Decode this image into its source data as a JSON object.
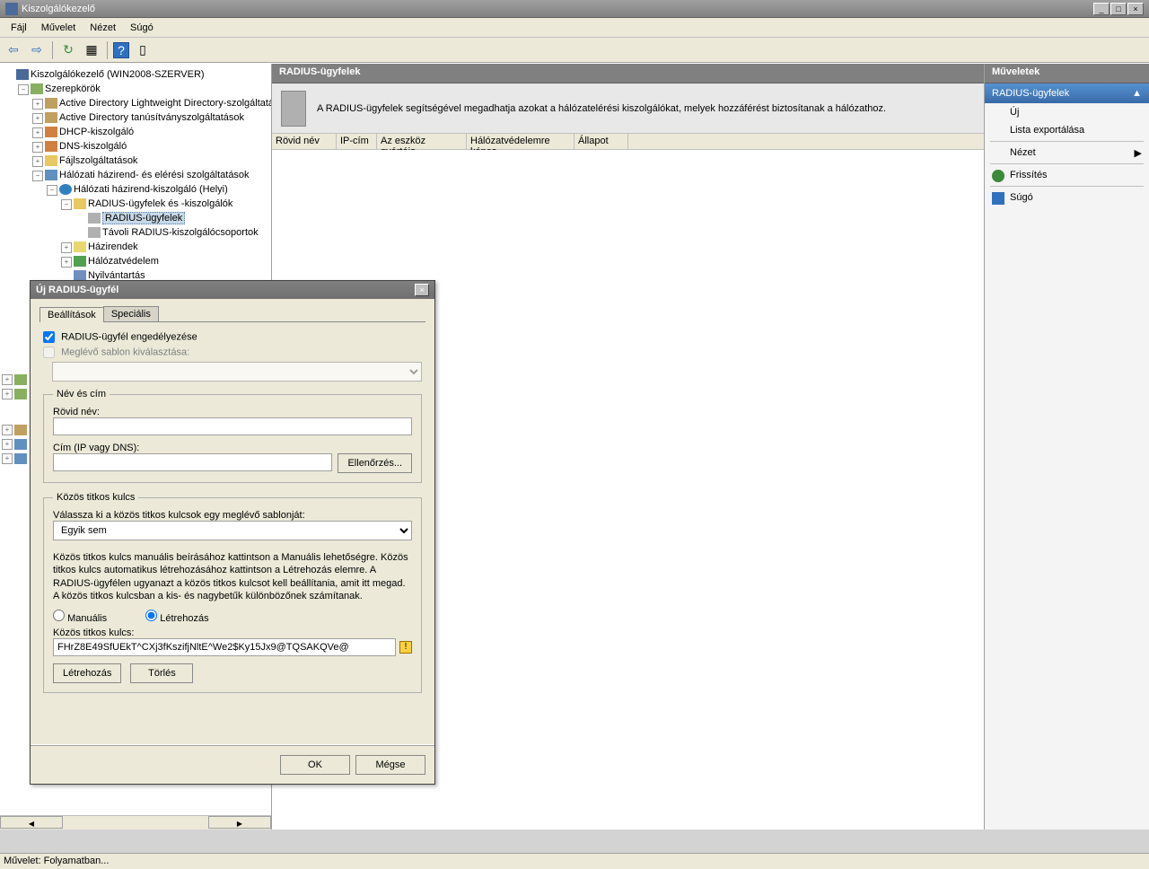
{
  "window": {
    "title": "Kiszolgálókezelő",
    "min": "_",
    "max": "□",
    "close": "×"
  },
  "menu": [
    "Fájl",
    "Művelet",
    "Nézet",
    "Súgó"
  ],
  "toolbar": {
    "back": "⇦",
    "fwd": "⇨",
    "up": "↻",
    "list": "▦",
    "help": "?",
    "pane": "▯"
  },
  "tree": {
    "root": "Kiszolgálókezelő (WIN2008-SZERVER)",
    "roles": "Szerepkörök",
    "adlds": "Active Directory Lightweight Directory-szolgáltatás",
    "adcs": "Active Directory tanúsítványszolgáltatások",
    "dhcp": "DHCP-kiszolgáló",
    "dns": "DNS-kiszolgáló",
    "file": "Fájlszolgáltatások",
    "nps_root": "Hálózati házirend- és elérési szolgáltatások",
    "nps_local": "Hálózati házirend-kiszolgáló (Helyi)",
    "radius_clients_servers": "RADIUS-ügyfelek és -kiszolgálók",
    "radius_clients": "RADIUS-ügyfelek",
    "remote_radius": "Távoli RADIUS-kiszolgálócsoportok",
    "policies": "Házirendek",
    "nap": "Hálózatvédelem",
    "accounting": "Nyilvántartás"
  },
  "center": {
    "title": "RADIUS-ügyfelek",
    "desc": "A RADIUS-ügyfelek segítségével megadhatja azokat a hálózatelérési kiszolgálókat, melyek hozzáférést biztosítanak a hálózathoz.",
    "cols": [
      "Rövid név",
      "IP-cím",
      "Az eszköz gyártója",
      "Hálózatvédelemre képes",
      "Állapot"
    ]
  },
  "actions": {
    "title": "Műveletek",
    "subtitle": "RADIUS-ügyfelek",
    "new": "Új",
    "export": "Lista exportálása",
    "view": "Nézet",
    "refresh": "Frissítés",
    "help": "Súgó"
  },
  "dialog": {
    "title": "Új RADIUS-ügyfél",
    "tab_settings": "Beállítások",
    "tab_advanced": "Speciális",
    "chk_enable": "RADIUS-ügyfél engedélyezése",
    "chk_template": "Meglévő sablon kiválasztása:",
    "fs_name": "Név és cím",
    "l_friendly": "Rövid név:",
    "l_addr": "Cím (IP vagy DNS):",
    "btn_verify": "Ellenőrzés...",
    "fs_secret": "Közös titkos kulcs",
    "l_template": "Válassza ki a közös titkos kulcsok egy meglévő sablonját:",
    "opt_none": "Egyik sem",
    "secret_help": "Közös titkos kulcs manuális beírásához kattintson a Manuális lehetőségre. Közös titkos kulcs automatikus létrehozásához kattintson a Létrehozás elemre. A RADIUS-ügyfélen ugyanazt a közös titkos kulcsot kell beállítania, amit itt megad. A közös titkos kulcsban a kis- és nagybetűk különbözőnek számítanak.",
    "r_manual": "Manuális",
    "r_generate": "Létrehozás",
    "l_secret": "Közös titkos kulcs:",
    "secret_value": "FHrZ8E49SfUEkT^CXj3fKszifjNltE^We2$Ky15Jx9@TQSAKQVe@",
    "btn_generate": "Létrehozás",
    "btn_clear": "Törlés",
    "btn_ok": "OK",
    "btn_cancel": "Mégse"
  },
  "status": "Művelet: Folyamatban..."
}
